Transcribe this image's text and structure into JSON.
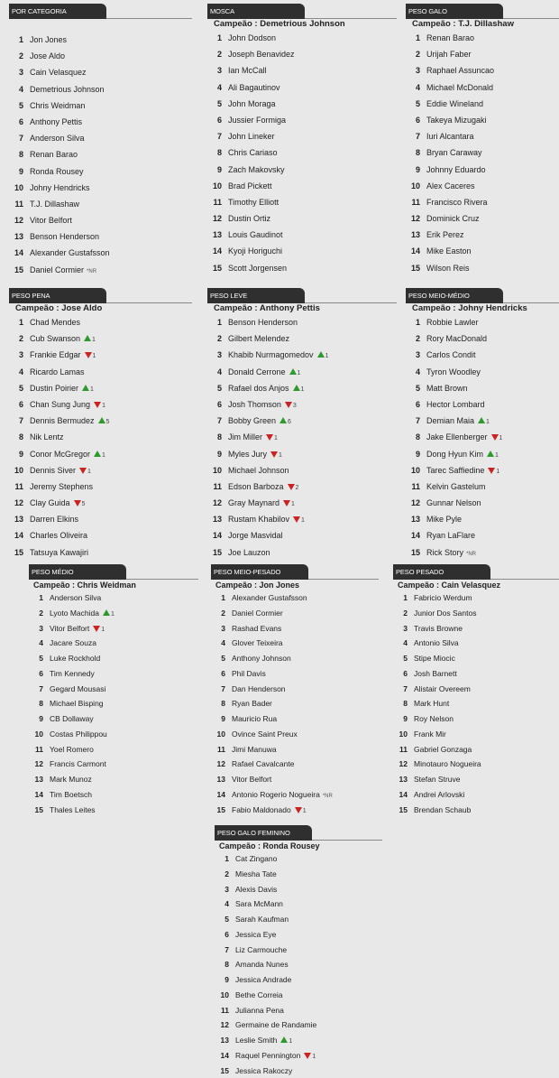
{
  "panels": [
    {
      "title": "POR CATEGORIA",
      "champion": "",
      "fighters": [
        {
          "rank": "1",
          "name": "Jon Jones"
        },
        {
          "rank": "2",
          "name": "Jose Aldo"
        },
        {
          "rank": "3",
          "name": "Cain Velasquez"
        },
        {
          "rank": "4",
          "name": "Demetrious Johnson"
        },
        {
          "rank": "5",
          "name": "Chris Weidman"
        },
        {
          "rank": "6",
          "name": "Anthony Pettis"
        },
        {
          "rank": "7",
          "name": "Anderson Silva"
        },
        {
          "rank": "8",
          "name": "Renan Barao"
        },
        {
          "rank": "9",
          "name": "Ronda Rousey"
        },
        {
          "rank": "10",
          "name": "Johny Hendricks"
        },
        {
          "rank": "11",
          "name": "T.J. Dillashaw"
        },
        {
          "rank": "12",
          "name": "Vitor Belfort"
        },
        {
          "rank": "13",
          "name": "Benson Henderson"
        },
        {
          "rank": "14",
          "name": "Alexander Gustafsson"
        },
        {
          "rank": "15",
          "name": "Daniel Cormier",
          "note": "*NR"
        }
      ]
    },
    {
      "title": "MOSCA",
      "champion": "Campeão : Demetrious Johnson",
      "fighters": [
        {
          "rank": "1",
          "name": "John Dodson"
        },
        {
          "rank": "2",
          "name": "Joseph Benavidez"
        },
        {
          "rank": "3",
          "name": "Ian McCall"
        },
        {
          "rank": "4",
          "name": "Ali Bagautinov"
        },
        {
          "rank": "5",
          "name": "John Moraga"
        },
        {
          "rank": "6",
          "name": "Jussier Formiga"
        },
        {
          "rank": "7",
          "name": "John Lineker"
        },
        {
          "rank": "8",
          "name": "Chris Cariaso"
        },
        {
          "rank": "9",
          "name": "Zach Makovsky"
        },
        {
          "rank": "10",
          "name": "Brad Pickett"
        },
        {
          "rank": "11",
          "name": "Timothy Elliott"
        },
        {
          "rank": "12",
          "name": "Dustin Ortiz"
        },
        {
          "rank": "13",
          "name": "Louis Gaudinot"
        },
        {
          "rank": "14",
          "name": "Kyoji Horiguchi"
        },
        {
          "rank": "15",
          "name": "Scott Jorgensen"
        }
      ]
    },
    {
      "title": "PESO GALO",
      "champion": "Campeão : T.J. Dillashaw",
      "fighters": [
        {
          "rank": "1",
          "name": "Renan Barao"
        },
        {
          "rank": "2",
          "name": "Urijah Faber"
        },
        {
          "rank": "3",
          "name": "Raphael Assuncao"
        },
        {
          "rank": "4",
          "name": "Michael McDonald"
        },
        {
          "rank": "5",
          "name": "Eddie Wineland"
        },
        {
          "rank": "6",
          "name": "Takeya Mizugaki"
        },
        {
          "rank": "7",
          "name": "Iuri Alcantara"
        },
        {
          "rank": "8",
          "name": "Bryan Caraway"
        },
        {
          "rank": "9",
          "name": "Johnny Eduardo"
        },
        {
          "rank": "10",
          "name": "Alex Caceres"
        },
        {
          "rank": "11",
          "name": "Francisco Rivera"
        },
        {
          "rank": "12",
          "name": "Dominick Cruz"
        },
        {
          "rank": "13",
          "name": "Erik Perez"
        },
        {
          "rank": "14",
          "name": "Mike Easton"
        },
        {
          "rank": "15",
          "name": "Wilson Reis"
        }
      ]
    },
    {
      "title": "PESO PENA",
      "champion": "Campeão : Jose Aldo",
      "fighters": [
        {
          "rank": "1",
          "name": "Chad Mendes"
        },
        {
          "rank": "2",
          "name": "Cub Swanson",
          "dir": "up",
          "change": "1"
        },
        {
          "rank": "3",
          "name": "Frankie Edgar",
          "dir": "down",
          "change": "1"
        },
        {
          "rank": "4",
          "name": "Ricardo Lamas"
        },
        {
          "rank": "5",
          "name": "Dustin Poirier",
          "dir": "up",
          "change": "1"
        },
        {
          "rank": "6",
          "name": "Chan Sung Jung",
          "dir": "down",
          "change": "1"
        },
        {
          "rank": "7",
          "name": "Dennis Bermudez",
          "dir": "up",
          "change": "5"
        },
        {
          "rank": "8",
          "name": "Nik Lentz"
        },
        {
          "rank": "9",
          "name": "Conor McGregor",
          "dir": "up",
          "change": "1"
        },
        {
          "rank": "10",
          "name": "Dennis Siver",
          "dir": "down",
          "change": "1"
        },
        {
          "rank": "11",
          "name": "Jeremy Stephens"
        },
        {
          "rank": "12",
          "name": "Clay Guida",
          "dir": "down",
          "change": "5"
        },
        {
          "rank": "13",
          "name": "Darren Elkins"
        },
        {
          "rank": "14",
          "name": "Charles Oliveira"
        },
        {
          "rank": "15",
          "name": "Tatsuya Kawajiri"
        }
      ]
    },
    {
      "title": "PESO LEVE",
      "champion": "Campeão : Anthony Pettis",
      "fighters": [
        {
          "rank": "1",
          "name": "Benson Henderson"
        },
        {
          "rank": "2",
          "name": "Gilbert Melendez"
        },
        {
          "rank": "3",
          "name": "Khabib Nurmagomedov",
          "dir": "up",
          "change": "1"
        },
        {
          "rank": "4",
          "name": "Donald Cerrone",
          "dir": "up",
          "change": "1"
        },
        {
          "rank": "5",
          "name": "Rafael dos Anjos",
          "dir": "up",
          "change": "1"
        },
        {
          "rank": "6",
          "name": "Josh Thomson",
          "dir": "down",
          "change": "3"
        },
        {
          "rank": "7",
          "name": "Bobby Green",
          "dir": "up",
          "change": "6"
        },
        {
          "rank": "8",
          "name": "Jim Miller",
          "dir": "down",
          "change": "1"
        },
        {
          "rank": "9",
          "name": "Myles Jury",
          "dir": "down",
          "change": "1"
        },
        {
          "rank": "10",
          "name": "Michael Johnson"
        },
        {
          "rank": "11",
          "name": "Edson Barboza",
          "dir": "down",
          "change": "2"
        },
        {
          "rank": "12",
          "name": "Gray Maynard",
          "dir": "down",
          "change": "1"
        },
        {
          "rank": "13",
          "name": "Rustam Khabilov",
          "dir": "down",
          "change": "1"
        },
        {
          "rank": "14",
          "name": "Jorge Masvidal"
        },
        {
          "rank": "15",
          "name": "Joe Lauzon"
        }
      ]
    },
    {
      "title": "PESO MEIO-MÉDIO",
      "champion": "Campeão : Johny Hendricks",
      "fighters": [
        {
          "rank": "1",
          "name": "Robbie Lawler"
        },
        {
          "rank": "2",
          "name": "Rory MacDonald"
        },
        {
          "rank": "3",
          "name": "Carlos Condit"
        },
        {
          "rank": "4",
          "name": "Tyron Woodley"
        },
        {
          "rank": "5",
          "name": "Matt Brown"
        },
        {
          "rank": "6",
          "name": "Hector Lombard"
        },
        {
          "rank": "7",
          "name": "Demian Maia",
          "dir": "up",
          "change": "1"
        },
        {
          "rank": "8",
          "name": "Jake Ellenberger",
          "dir": "down",
          "change": "1"
        },
        {
          "rank": "9",
          "name": "Dong Hyun Kim",
          "dir": "up",
          "change": "1"
        },
        {
          "rank": "10",
          "name": "Tarec Saffiedine",
          "dir": "down",
          "change": "1"
        },
        {
          "rank": "11",
          "name": "Kelvin Gastelum"
        },
        {
          "rank": "12",
          "name": "Gunnar Nelson"
        },
        {
          "rank": "13",
          "name": "Mike Pyle"
        },
        {
          "rank": "14",
          "name": "Ryan LaFlare"
        },
        {
          "rank": "15",
          "name": "Rick Story",
          "note": "*NR"
        }
      ]
    },
    {
      "title": "PESO MÉDIO",
      "champion": "Campeão : Chris Weidman",
      "fighters": [
        {
          "rank": "1",
          "name": "Anderson Silva"
        },
        {
          "rank": "2",
          "name": "Lyoto Machida",
          "dir": "up",
          "change": "1"
        },
        {
          "rank": "3",
          "name": "Vitor Belfort",
          "dir": "down",
          "change": "1"
        },
        {
          "rank": "4",
          "name": "Jacare Souza"
        },
        {
          "rank": "5",
          "name": "Luke Rockhold"
        },
        {
          "rank": "6",
          "name": "Tim Kennedy"
        },
        {
          "rank": "7",
          "name": "Gegard Mousasi"
        },
        {
          "rank": "8",
          "name": "Michael Bisping"
        },
        {
          "rank": "9",
          "name": "CB Dollaway"
        },
        {
          "rank": "10",
          "name": "Costas Philippou"
        },
        {
          "rank": "11",
          "name": "Yoel Romero"
        },
        {
          "rank": "12",
          "name": "Francis Carmont"
        },
        {
          "rank": "13",
          "name": "Mark Munoz"
        },
        {
          "rank": "14",
          "name": "Tim Boetsch"
        },
        {
          "rank": "15",
          "name": "Thales Leites"
        }
      ]
    },
    {
      "title": "PESO MEIO-PESADO",
      "champion": "Campeão : Jon Jones",
      "fighters": [
        {
          "rank": "1",
          "name": "Alexander Gustafsson"
        },
        {
          "rank": "2",
          "name": "Daniel Cormier"
        },
        {
          "rank": "3",
          "name": "Rashad Evans"
        },
        {
          "rank": "4",
          "name": "Glover Teixeira"
        },
        {
          "rank": "5",
          "name": "Anthony Johnson"
        },
        {
          "rank": "6",
          "name": "Phil Davis"
        },
        {
          "rank": "7",
          "name": "Dan Henderson"
        },
        {
          "rank": "8",
          "name": "Ryan Bader"
        },
        {
          "rank": "9",
          "name": "Mauricio Rua"
        },
        {
          "rank": "10",
          "name": "Ovince Saint Preux"
        },
        {
          "rank": "11",
          "name": "Jimi Manuwa"
        },
        {
          "rank": "12",
          "name": "Rafael Cavalcante"
        },
        {
          "rank": "13",
          "name": "Vitor Belfort"
        },
        {
          "rank": "14",
          "name": "Antonio Rogerio Nogueira",
          "note": "*NR"
        },
        {
          "rank": "15",
          "name": "Fabio Maldonado",
          "dir": "down",
          "change": "1"
        }
      ]
    },
    {
      "title": "PESO PESADO",
      "champion": "Campeão : Cain Velasquez",
      "fighters": [
        {
          "rank": "1",
          "name": "Fabricio Werdum"
        },
        {
          "rank": "2",
          "name": "Junior Dos Santos"
        },
        {
          "rank": "3",
          "name": "Travis Browne"
        },
        {
          "rank": "4",
          "name": "Antonio Silva"
        },
        {
          "rank": "5",
          "name": "Stipe Miocic"
        },
        {
          "rank": "6",
          "name": "Josh Barnett"
        },
        {
          "rank": "7",
          "name": "Alistair Overeem"
        },
        {
          "rank": "8",
          "name": "Mark Hunt"
        },
        {
          "rank": "9",
          "name": "Roy Nelson"
        },
        {
          "rank": "10",
          "name": "Frank Mir"
        },
        {
          "rank": "11",
          "name": "Gabriel Gonzaga"
        },
        {
          "rank": "12",
          "name": "Minotauro Nogueira"
        },
        {
          "rank": "13",
          "name": "Stefan Struve"
        },
        {
          "rank": "14",
          "name": "Andrei Arlovski"
        },
        {
          "rank": "15",
          "name": "Brendan Schaub"
        }
      ]
    },
    {
      "title": "PESO GALO FEMININO",
      "champion": "Campeão : Ronda Rousey",
      "fighters": [
        {
          "rank": "1",
          "name": "Cat Zingano"
        },
        {
          "rank": "2",
          "name": "Miesha Tate"
        },
        {
          "rank": "3",
          "name": "Alexis Davis"
        },
        {
          "rank": "4",
          "name": "Sara McMann"
        },
        {
          "rank": "5",
          "name": "Sarah Kaufman"
        },
        {
          "rank": "6",
          "name": "Jessica Eye"
        },
        {
          "rank": "7",
          "name": "Liz Carmouche"
        },
        {
          "rank": "8",
          "name": "Amanda Nunes"
        },
        {
          "rank": "9",
          "name": "Jessica Andrade"
        },
        {
          "rank": "10",
          "name": "Bethe Correia"
        },
        {
          "rank": "11",
          "name": "Julianna Pena"
        },
        {
          "rank": "12",
          "name": "Germaine de Randamie"
        },
        {
          "rank": "13",
          "name": "Leslie Smith",
          "dir": "up",
          "change": "1"
        },
        {
          "rank": "14",
          "name": "Raquel Pennington",
          "dir": "down",
          "change": "1"
        },
        {
          "rank": "15",
          "name": "Jessica Rakoczy"
        }
      ]
    }
  ],
  "colors": {
    "tab_bg": "#2f2f2f",
    "up": "#2e9a2e",
    "down": "#cc2222",
    "page_bg": "#e8e8e8"
  }
}
